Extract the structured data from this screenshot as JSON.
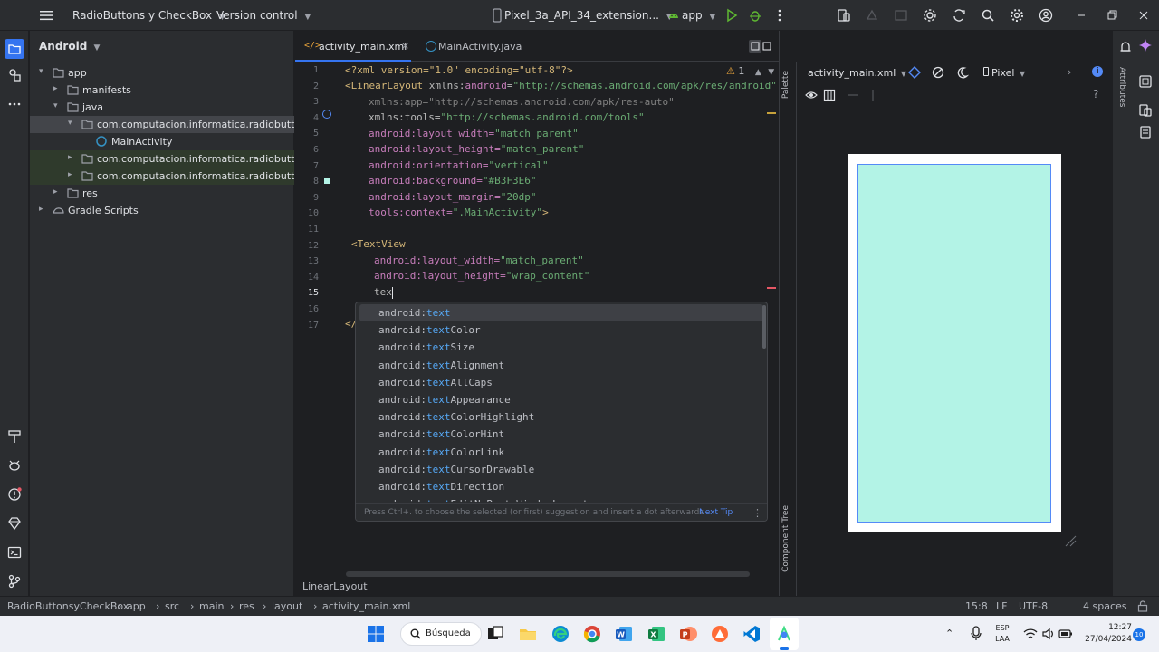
{
  "titlebar": {
    "project": "RadioButtons y CheckBox",
    "vcs": "Version control",
    "device": "Pixel_3a_API_34_extension...",
    "run_config": "app"
  },
  "project_panel": {
    "view": "Android",
    "tree": [
      {
        "label": "app",
        "indent": 0,
        "expanded": true,
        "icon": "folder-icon"
      },
      {
        "label": "manifests",
        "indent": 1,
        "expanded": false,
        "icon": "folder-icon"
      },
      {
        "label": "java",
        "indent": 1,
        "expanded": true,
        "icon": "folder-icon"
      },
      {
        "label": "com.computacion.informatica.radiobuttonsy",
        "indent": 2,
        "expanded": true,
        "icon": "package-icon",
        "selected": true
      },
      {
        "label": "MainActivity",
        "indent": 3,
        "expanded": null,
        "icon": "class-icon"
      },
      {
        "label": "com.computacion.informatica.radiobuttonsy",
        "indent": 2,
        "expanded": false,
        "icon": "package-icon",
        "tinted": true
      },
      {
        "label": "com.computacion.informatica.radiobuttonsy",
        "indent": 2,
        "expanded": false,
        "icon": "package-icon",
        "tinted": true
      },
      {
        "label": "res",
        "indent": 1,
        "expanded": false,
        "icon": "folder-icon"
      },
      {
        "label": "Gradle Scripts",
        "indent": 0,
        "expanded": false,
        "icon": "gradle-icon"
      }
    ]
  },
  "editor": {
    "tabs": [
      {
        "label": "activity_main.xml",
        "active": true
      },
      {
        "label": "MainActivity.java",
        "active": false
      }
    ],
    "warning_count": "1",
    "breadcrumb": "LinearLayout",
    "line_numbers": [
      "1",
      "2",
      "3",
      "4",
      "5",
      "6",
      "7",
      "8",
      "9",
      "10",
      "11",
      "12",
      "13",
      "14",
      "15",
      "16",
      "17"
    ],
    "lines": {
      "l1_decl": "<?xml version=\"1.0\" encoding=\"utf-8\"?>",
      "l2_tag": "<LinearLayout",
      "l2_xmlns": "xmlns:",
      "l2_ns": "android",
      "l2_eq": "=",
      "l2_val": "\"http://schemas.android.com/apk/res/android\"",
      "l3": "xmlns:app=\"http://schemas.android.com/apk/res-auto\"",
      "l4_attr": "xmlns:tools=",
      "l4_val": "\"http://schemas.android.com/tools\"",
      "l5_attr": "android:layout_width=",
      "l5_val": "\"match_parent\"",
      "l6_attr": "android:layout_height=",
      "l6_val": "\"match_parent\"",
      "l7_attr": "android:orientation=",
      "l7_val": "\"vertical\"",
      "l8_attr": "android:background=",
      "l8_val": "\"#B3F3E6\"",
      "l9_attr": "android:layout_margin=",
      "l9_val": "\"20dp\"",
      "l10_attr": "tools:context=",
      "l10_val": "\".MainActivity\"",
      "l10_end": ">",
      "l12": "<TextView",
      "l13_attr": "android:layout_width=",
      "l13_val": "\"match_parent\"",
      "l14_attr": "android:layout_height=",
      "l14_val": "\"wrap_content\"",
      "l15": "tex",
      "l17": "</"
    },
    "autocomplete": {
      "prefix_ns": "android:",
      "suggestions": [
        {
          "match": "text",
          "rest": ""
        },
        {
          "match": "text",
          "rest": "Color"
        },
        {
          "match": "text",
          "rest": "Size"
        },
        {
          "match": "text",
          "rest": "Alignment"
        },
        {
          "match": "text",
          "rest": "AllCaps"
        },
        {
          "match": "text",
          "rest": "Appearance"
        },
        {
          "match": "text",
          "rest": "ColorHighlight"
        },
        {
          "match": "text",
          "rest": "ColorHint"
        },
        {
          "match": "text",
          "rest": "ColorLink"
        },
        {
          "match": "text",
          "rest": "CursorDrawable"
        },
        {
          "match": "text",
          "rest": "Direction"
        },
        {
          "match": "text",
          "rest": "EditNoPasteWindowLayout"
        }
      ],
      "hint": "Press Ctrl+. to choose the selected (or first) suggestion and insert a dot afterwards",
      "next_tip": "Next Tip"
    }
  },
  "design": {
    "file": "activity_main.xml",
    "device": "Pixel",
    "palette_label": "Palette",
    "component_tree_label": "Component Tree",
    "attributes_label": "Attributes",
    "preview_bg": "#B3F3E6"
  },
  "pathbar": {
    "crumbs": [
      "RadioButtonsyCheckBox",
      "app",
      "src",
      "main",
      "res",
      "layout",
      "activity_main.xml"
    ],
    "position": "15:8",
    "line_sep": "LF",
    "encoding": "UTF-8",
    "indent": "4 spaces"
  },
  "taskbar": {
    "search": "Búsqueda",
    "lang1": "ESP",
    "lang2": "LAA",
    "time": "12:27",
    "date": "27/04/2024",
    "notifications": "10"
  }
}
